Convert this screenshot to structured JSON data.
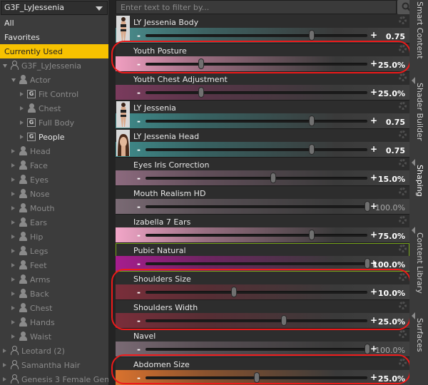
{
  "left": {
    "dropdown": "G3F_LyJessenia",
    "items": [
      {
        "label": "All"
      },
      {
        "label": "Favorites"
      },
      {
        "label": "Currently Used"
      }
    ],
    "tree": [
      {
        "label": "G3F_LyJessenia",
        "indent": 0,
        "type": "fig-out",
        "expander": "open"
      },
      {
        "label": "Actor",
        "indent": 1,
        "type": "fig",
        "expander": "open"
      },
      {
        "label": "Fit Control",
        "indent": 2,
        "type": "group",
        "expander": "closed"
      },
      {
        "label": "Chest",
        "indent": 2,
        "type": "fig",
        "expander": "closed"
      },
      {
        "label": "Full Body",
        "indent": 2,
        "type": "group",
        "expander": "closed"
      },
      {
        "label": "People",
        "indent": 2,
        "type": "group",
        "expander": "closed",
        "white": true
      },
      {
        "label": "Head",
        "indent": 1,
        "type": "fig",
        "expander": "closed"
      },
      {
        "label": "Face",
        "indent": 1,
        "type": "fig",
        "expander": "closed"
      },
      {
        "label": "Eyes",
        "indent": 1,
        "type": "fig",
        "expander": "closed"
      },
      {
        "label": "Nose",
        "indent": 1,
        "type": "fig",
        "expander": "closed"
      },
      {
        "label": "Mouth",
        "indent": 1,
        "type": "fig",
        "expander": "closed"
      },
      {
        "label": "Ears",
        "indent": 1,
        "type": "fig",
        "expander": "closed"
      },
      {
        "label": "Hip",
        "indent": 1,
        "type": "fig",
        "expander": "closed"
      },
      {
        "label": "Legs",
        "indent": 1,
        "type": "fig",
        "expander": "closed"
      },
      {
        "label": "Feet",
        "indent": 1,
        "type": "fig",
        "expander": "closed"
      },
      {
        "label": "Arms",
        "indent": 1,
        "type": "fig",
        "expander": "closed"
      },
      {
        "label": "Back",
        "indent": 1,
        "type": "fig",
        "expander": "closed"
      },
      {
        "label": "Chest",
        "indent": 1,
        "type": "fig",
        "expander": "closed"
      },
      {
        "label": "Hands",
        "indent": 1,
        "type": "fig",
        "expander": "closed"
      },
      {
        "label": "Waist",
        "indent": 1,
        "type": "fig",
        "expander": "closed"
      },
      {
        "label": "Leotard (2)",
        "indent": 0,
        "type": "fig-out",
        "expander": "closed"
      },
      {
        "label": "Samantha Hair",
        "indent": 0,
        "type": "fig-out",
        "expander": "closed"
      },
      {
        "label": "Genesis 3 Female Geni...",
        "indent": 0,
        "type": "fig-out",
        "expander": "closed"
      }
    ]
  },
  "filter": {
    "placeholder": "Enter text to filter by..."
  },
  "colors": {
    "selected": "#f7c200",
    "annotation": "#ee1a1a"
  },
  "sliders": [
    {
      "label": "LY Jessenia Body",
      "value": "0.75",
      "fraction": 0.75,
      "color": "#4a8e8e",
      "thumb": "body",
      "annotated": false,
      "dim": false
    },
    {
      "label": "Youth Posture",
      "value": "25.0%",
      "fraction": 0.25,
      "color": "#f09ec0",
      "thumb": null,
      "annotated": true,
      "dim": false
    },
    {
      "label": "Youth Chest Adjustment",
      "value": "25.0%",
      "fraction": 0.25,
      "color": "#7a3b5d",
      "thumb": null,
      "annotated": false,
      "dim": false
    },
    {
      "label": "LY Jessenia",
      "value": "0.75",
      "fraction": 0.75,
      "color": "#3f8c8c",
      "thumb": "body",
      "annotated": false,
      "dim": false
    },
    {
      "label": "LY Jessenia Head",
      "value": "0.75",
      "fraction": 0.75,
      "color": "#3f8c8c",
      "thumb": "head",
      "annotated": false,
      "dim": false
    },
    {
      "label": "Eyes Iris Correction",
      "value": "15.0%",
      "fraction": 0.575,
      "color": "#8c6a7e",
      "thumb": null,
      "annotated": false,
      "dim": false
    },
    {
      "label": "Mouth Realism HD",
      "value": "100.0%",
      "fraction": 1.0,
      "color": "#7a6a74",
      "thumb": null,
      "annotated": false,
      "dim": true
    },
    {
      "label": "Izabella 7 Ears",
      "value": "75.0%",
      "fraction": 0.75,
      "color": "#f2a6c8",
      "thumb": null,
      "annotated": false,
      "dim": false
    },
    {
      "label": "Pubic Natural",
      "value": "100.0%",
      "fraction": 1.0,
      "color": "#a61d8e",
      "thumb": null,
      "annotated": false,
      "dim": false,
      "outline": true
    },
    {
      "label": "Shoulders Size",
      "value": "10.0%",
      "fraction": 0.4,
      "color": "#7a2e3a",
      "thumb": null,
      "annotated": true,
      "dim": false
    },
    {
      "label": "Shoulders Width",
      "value": "25.0%",
      "fraction": 0.625,
      "color": "#7a2e3a",
      "thumb": null,
      "annotated": true,
      "dim": false
    },
    {
      "label": "Navel",
      "value": "100.0%",
      "fraction": 1.0,
      "color": "#7a6a74",
      "thumb": null,
      "annotated": false,
      "dim": true
    },
    {
      "label": "Abdomen Size",
      "value": "25.0%",
      "fraction": 0.5,
      "color": "#d9722e",
      "thumb": null,
      "annotated": true,
      "dim": false
    }
  ],
  "vtabs": [
    {
      "label": "Smart Content"
    },
    {
      "label": "Shader Builder"
    },
    {
      "label": "Shaping"
    },
    {
      "label": "Content Library"
    },
    {
      "label": "Surfaces"
    }
  ]
}
